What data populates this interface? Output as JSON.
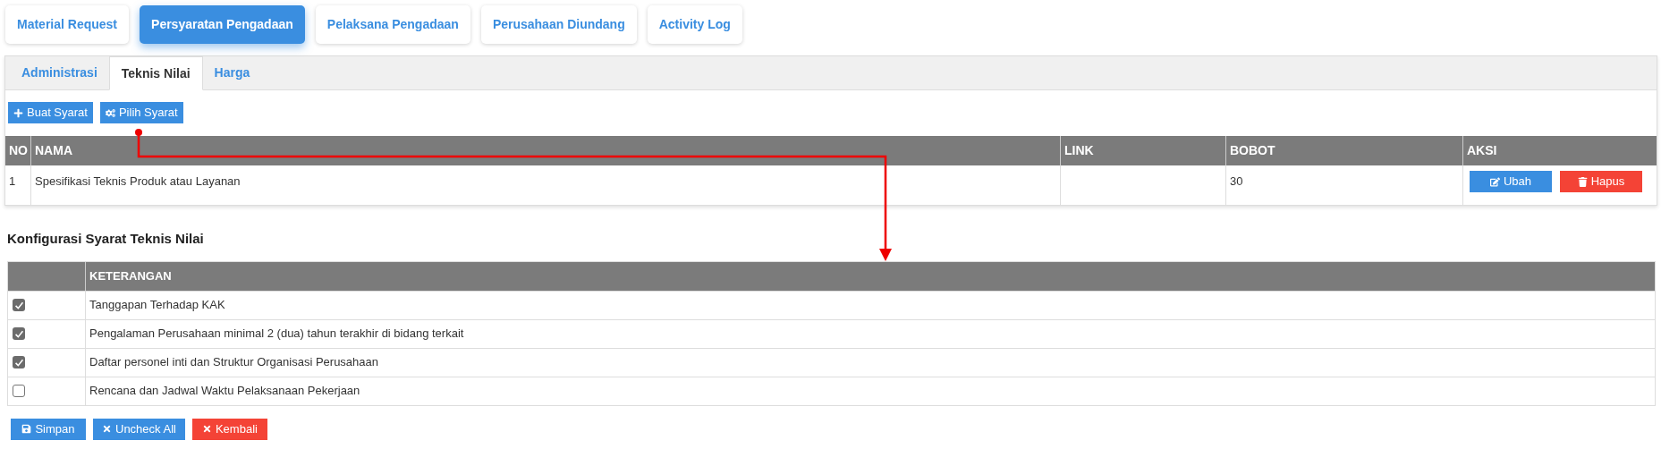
{
  "top_tabs": [
    {
      "label": "Material Request",
      "selected": false
    },
    {
      "label": "Persyaratan Pengadaan",
      "selected": true
    },
    {
      "label": "Pelaksana Pengadaan",
      "selected": false
    },
    {
      "label": "Perusahaan Diundang",
      "selected": false
    },
    {
      "label": "Activity Log",
      "selected": false
    }
  ],
  "sub_tabs": [
    {
      "label": "Administrasi",
      "selected": false
    },
    {
      "label": "Teknis Nilai",
      "selected": true
    },
    {
      "label": "Harga",
      "selected": false
    }
  ],
  "toolbar": [
    {
      "label": "Buat Syarat",
      "kind": "add"
    },
    {
      "label": "Pilih Syarat",
      "kind": "choose"
    }
  ],
  "requirements_table": {
    "columns": [
      "NO",
      "NAMA",
      "LINK",
      "BOBOT",
      "AKSI"
    ],
    "rows": [
      {
        "no": "1",
        "name": "Spesifikasi Teknis Produk atau Layanan",
        "weight": "30",
        "actions": [
          {
            "label": "Ubah",
            "kind": "edit"
          },
          {
            "label": "Hapus",
            "kind": "delete"
          }
        ]
      }
    ]
  },
  "config": {
    "title": "Konfigurasi Syarat Teknis Nilai",
    "columns": [
      "KETERANGAN"
    ],
    "rows": [
      {
        "label": "Tanggapan Terhadap KAK",
        "checked": true
      },
      {
        "label": "Pengalaman Perusahaan minimal 2 (dua) tahun terakhir di bidang terkait",
        "checked": true
      },
      {
        "label": "Daftar personel inti dan Struktur Organisasi Perusahaan",
        "checked": true
      },
      {
        "label": "Rencana dan Jadwal Waktu Pelaksanaan Pekerjaan",
        "checked": false
      }
    ],
    "buttons": [
      {
        "label": "Simpan",
        "kind": "save"
      },
      {
        "label": "Uncheck All",
        "kind": "uncheck"
      },
      {
        "label": "Kembali",
        "kind": "back"
      }
    ]
  }
}
